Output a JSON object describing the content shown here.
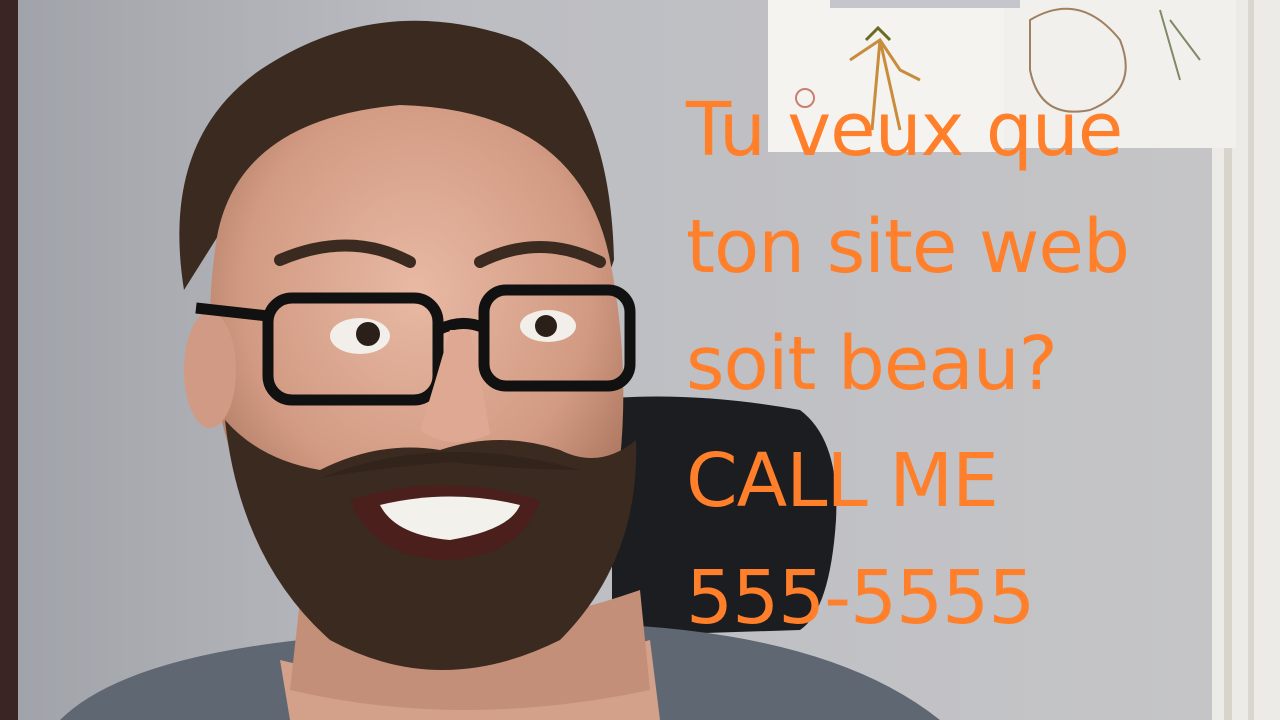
{
  "overlay": {
    "lines": [
      "Tu veux que",
      "ton site web",
      "soit beau?",
      "CALL ME",
      "555-5555"
    ]
  },
  "colors": {
    "overlay_text": "#ff7f2a",
    "wall": "#bdbec2",
    "door_frame": "#efedea",
    "chair": "#1c1d20",
    "shirt": "#5d6670",
    "skin": "#d7a38c",
    "hair_beard": "#3a2a20"
  }
}
